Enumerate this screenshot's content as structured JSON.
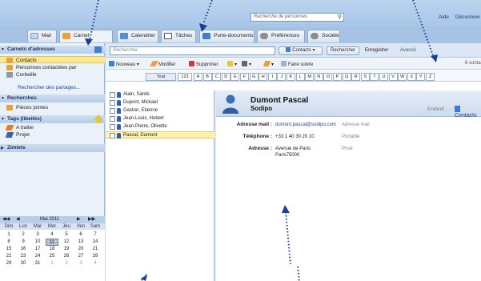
{
  "top": {
    "search_placeholder": "Recherche de personnes",
    "links": [
      "Aide",
      "Déconnexi"
    ]
  },
  "apptabs": [
    "Mail",
    "Carnet d'adresses",
    "Calendrier",
    "Tâches",
    "Porte-documents",
    "Préférences",
    "Société"
  ],
  "sidebar": {
    "carnets_header": "Carnets d'adresses",
    "items": [
      "Contacts",
      "Personnes contactées par",
      "Corbeille"
    ],
    "partage_link": "Rechercher des partages...",
    "recherches_header": "Recherches",
    "recherches_items": [
      "Pièces jointes"
    ],
    "tags_header": "Tags (libellés)",
    "tags_items": [
      "A traiter",
      "Projet"
    ],
    "zimlets_header": "Zimlets"
  },
  "calendar": {
    "month": "Mai 2011",
    "dow": [
      "Dim",
      "Lun",
      "Mar",
      "Mer",
      "Jeu",
      "Ven",
      "Sam"
    ],
    "weeks": [
      [
        "1",
        "2",
        "3",
        "4",
        "5",
        "6",
        "7"
      ],
      [
        "8",
        "9",
        "10",
        "11",
        "12",
        "13",
        "14"
      ],
      [
        "15",
        "16",
        "17",
        "18",
        "19",
        "20",
        "21"
      ],
      [
        "22",
        "23",
        "24",
        "25",
        "26",
        "27",
        "28"
      ],
      [
        "29",
        "30",
        "31",
        "1",
        "2",
        "3",
        "4"
      ]
    ],
    "today": "11"
  },
  "search": {
    "placeholder": "Rechercher",
    "scope": "Contacts",
    "search_btn": "Rechercher",
    "save_btn": "Enregistrer",
    "advanced": "Avancé"
  },
  "toolbar": {
    "new": "Nouveau",
    "edit": "Modifier",
    "delete": "Supprimer",
    "forward": "Faire suivre",
    "count": "6 conta"
  },
  "alphabet": [
    "Tout",
    "123",
    "A",
    "B",
    "C",
    "D",
    "E",
    "F",
    "G",
    "H",
    "I",
    "J",
    "K",
    "L",
    "M",
    "N",
    "O",
    "P",
    "Q",
    "R",
    "S",
    "T",
    "U",
    "V",
    "W",
    "X",
    "Y",
    "Z"
  ],
  "contacts": [
    "Alain, Sarde",
    "Dupont, Mickael",
    "Gaston, Etienne",
    "Jean-Louis, Hobert",
    "Jean-Pierre, Olivette",
    "Pascal, Dumont"
  ],
  "detail": {
    "name": "Dumont Pascal",
    "company": "Sodipo",
    "location_label": "Endroit :",
    "folder": "Contacts",
    "email_label": "Adresse mail :",
    "email": "dumont.pascal@sodipo.com",
    "email_type": "Adresse mail",
    "phone_label": "Téléphone :",
    "phone": "+33 1 40 30 20 10",
    "phone_type": "Portable",
    "address_label": "Adresse :",
    "address_line1": "Avenue de Paris",
    "address_line2": "Paris75000",
    "address_type": "Privé"
  }
}
